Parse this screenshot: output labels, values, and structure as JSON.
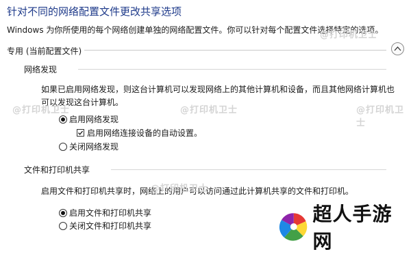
{
  "title": "针对不同的网络配置文件更改共享选项",
  "description": "Windows 为你所使用的每个网络创建单独的网络配置文件。你可以针对每个配置文件选择特定的选项。",
  "profile_section": {
    "label": "专用 (当前配置文件)"
  },
  "network_discovery": {
    "heading": "网络发现",
    "paragraph": "如果已启用网络发现，则这台计算机可以发现网络上的其他计算机和设备，而且其他网络计算机也可以发现这台计算机。",
    "option_on": "启用网络发现",
    "auto_setup": "启用网络连接设备的自动设置。",
    "option_off": "关闭网络发现"
  },
  "file_printer_sharing": {
    "heading": "文件和打印机共享",
    "paragraph": "启用文件和打印机共享时，网络上的用户可以访问通过此计算机共享的文件和打印机。",
    "option_on": "启用文件和打印机共享",
    "option_off": "关闭文件和打印机共享"
  },
  "watermark": "@打印机卫士",
  "logo": {
    "text": "超人手游网",
    "colors": [
      "#e53935",
      "#1e88e5",
      "#43a047",
      "#fdd835"
    ]
  },
  "state": {
    "network_discovery_enabled": true,
    "auto_setup_checked": true,
    "file_sharing_enabled": true
  }
}
